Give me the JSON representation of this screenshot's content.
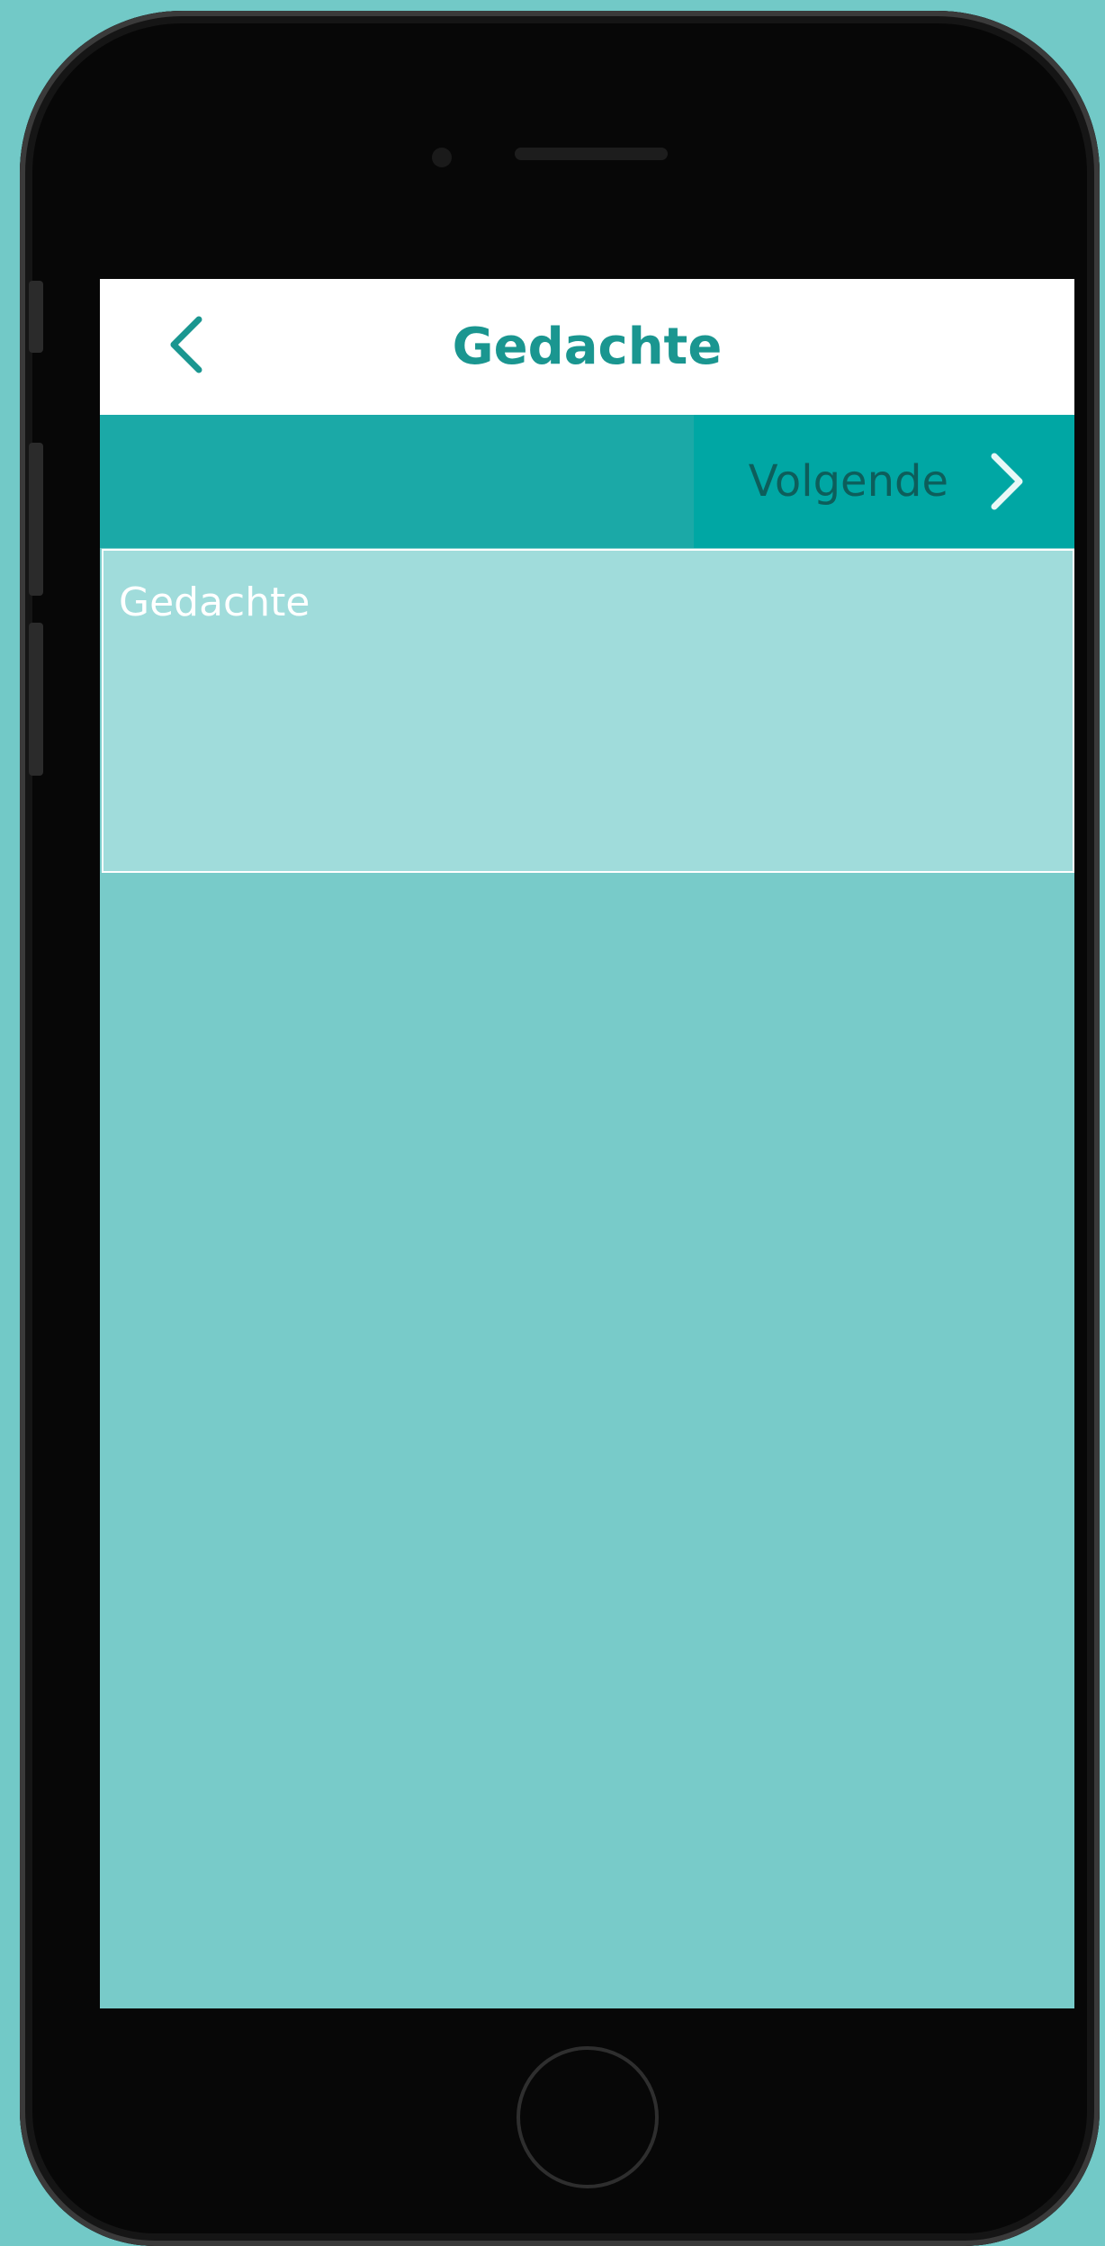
{
  "nav": {
    "title": "Gedachte",
    "back_icon": "chevron-left-icon"
  },
  "step_bar": {
    "next_label": "Volgende",
    "next_icon": "chevron-right-icon"
  },
  "thought_field": {
    "label": "Gedachte"
  },
  "colors": {
    "background": "#72c9c7",
    "nav_background": "#ffffff",
    "title_color": "#1a9690",
    "step_bar": "#1ba9a7",
    "next_button": "#00a7a4",
    "next_label": "#0d5e5b",
    "field_background": "#a0dcdb",
    "content_background": "#78cbc9"
  }
}
